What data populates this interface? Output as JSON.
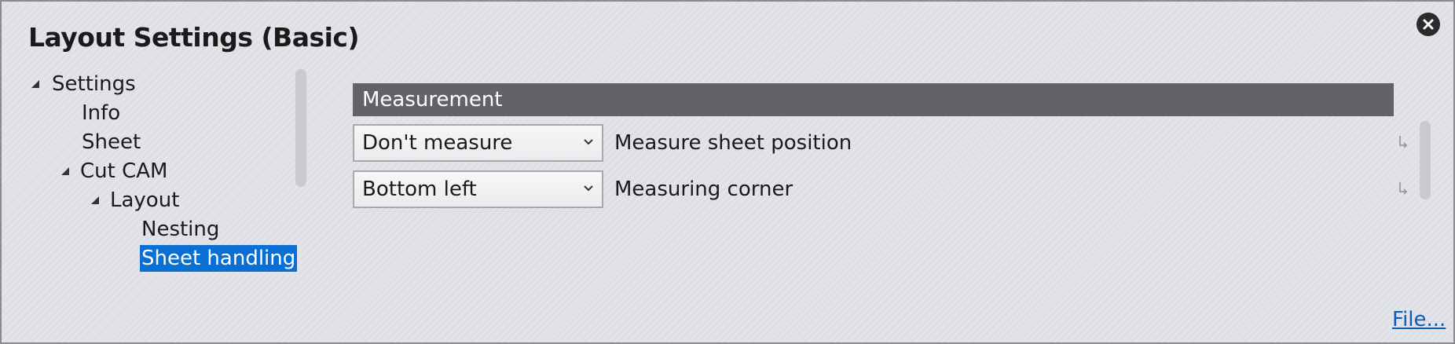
{
  "dialog": {
    "title": "Layout Settings (Basic)",
    "close_icon": "close-icon"
  },
  "tree": {
    "items": [
      {
        "label": "Settings",
        "expanded": true,
        "level": 0
      },
      {
        "label": "Info",
        "level": 1
      },
      {
        "label": "Sheet",
        "level": 1
      },
      {
        "label": "Cut CAM",
        "expanded": true,
        "level": 1
      },
      {
        "label": "Layout",
        "expanded": true,
        "level": 2
      },
      {
        "label": "Nesting",
        "level": 3
      },
      {
        "label": "Sheet handling",
        "level": 3,
        "selected": true
      }
    ]
  },
  "section": {
    "header": "Measurement",
    "rows": [
      {
        "value": "Don't measure",
        "label": "Measure sheet position"
      },
      {
        "value": "Bottom left",
        "label": "Measuring corner"
      }
    ]
  },
  "footer": {
    "file_link": "File..."
  },
  "colors": {
    "accent": "#0a6fd4",
    "header_bg": "#626368",
    "link": "#0a5cc0"
  }
}
